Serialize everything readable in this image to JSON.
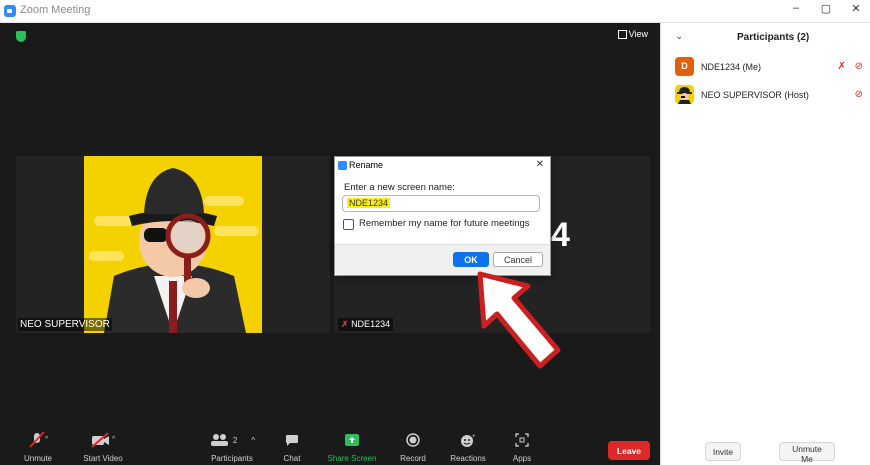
{
  "window": {
    "title": "Zoom Meeting",
    "minimize": "–",
    "restore": "▢",
    "close": "✕"
  },
  "meeting": {
    "view_label": "View",
    "tiles": [
      {
        "name": "NEO SUPERVISOR"
      },
      {
        "name": "NDE1234",
        "big_text": "4"
      }
    ]
  },
  "dialog": {
    "title": "Rename",
    "close": "✕",
    "label": "Enter a new screen name:",
    "input_value": "NDE1234",
    "checkbox_label": "Remember my name for future meetings",
    "ok_label": "OK",
    "cancel_label": "Cancel"
  },
  "toolbar": {
    "unmute": "Unmute",
    "start_video": "Start Video",
    "participants": "Participants",
    "participants_count": "2",
    "chat": "Chat",
    "share_screen": "Share Screen",
    "record": "Record",
    "reactions": "Reactions",
    "apps": "Apps",
    "leave": "Leave"
  },
  "sidebar": {
    "title": "Participants (2)",
    "participants": [
      {
        "initial": "D",
        "name": "NDE1234 (Me)",
        "avatar_color": "#e0600c"
      },
      {
        "initial": "",
        "name": "NEO SUPERVISOR (Host)",
        "avatar_color": "#f4d200"
      }
    ],
    "invite": "Invite",
    "unmute_me": "Unmute Me"
  },
  "colors": {
    "accent": "#0e72ed",
    "leave": "#e02828",
    "share": "#2dbd5d",
    "highlight": "#fff200"
  }
}
